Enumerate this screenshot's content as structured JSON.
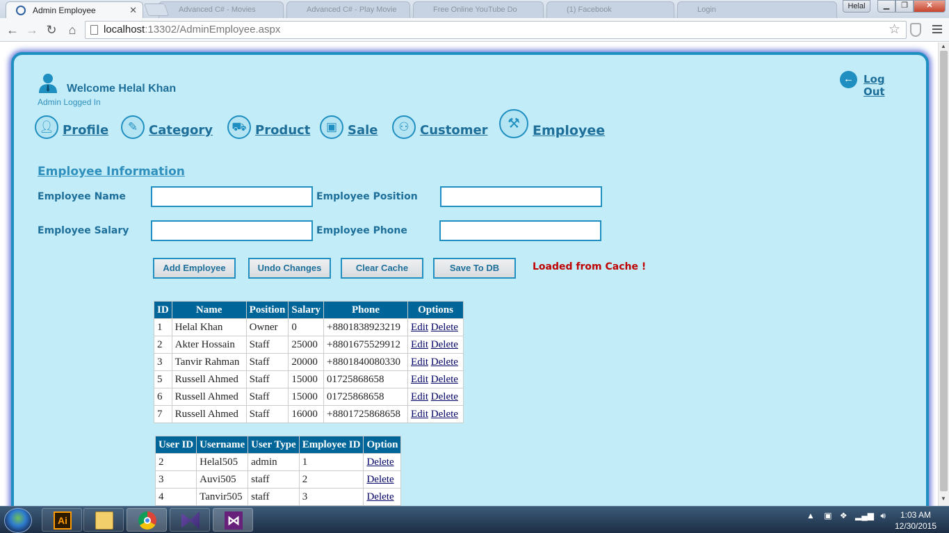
{
  "browser": {
    "active_tab_title": "Admin Employee",
    "background_tabs": [
      "Advanced C# - Movies",
      "Advanced C# - Play Movie",
      "Free Online YouTube Do",
      "(1) Facebook",
      "Login"
    ],
    "profile_name": "Helal",
    "url_host": "localhost",
    "url_rest": ":13302/AdminEmployee.aspx"
  },
  "header": {
    "welcome": "Welcome Helal Khan",
    "subtitle": "Admin Logged In",
    "logout": "Log Out"
  },
  "nav": {
    "items": [
      {
        "label": "Profile",
        "icon": "person-icon"
      },
      {
        "label": "Category",
        "icon": "category-icon"
      },
      {
        "label": "Product",
        "icon": "cart-icon"
      },
      {
        "label": "Sale",
        "icon": "bag-icon"
      },
      {
        "label": "Customer",
        "icon": "customers-icon"
      },
      {
        "label": "Employee",
        "icon": "employee-icon"
      }
    ]
  },
  "form": {
    "title": "Employee Information",
    "name_label": "Employee Name",
    "position_label": "Employee Position",
    "salary_label": "Employee Salary",
    "phone_label": "Employee Phone",
    "name_value": "",
    "position_value": "",
    "salary_value": "",
    "phone_value": "",
    "buttons": {
      "add": "Add Employee",
      "undo": "Undo Changes",
      "clear": "Clear Cache",
      "save": "Save To DB"
    },
    "status": "Loaded from Cache !"
  },
  "employees": {
    "columns": [
      "ID",
      "Name",
      "Position",
      "Salary",
      "Phone",
      "Options"
    ],
    "edit_label": "Edit",
    "delete_label": "Delete",
    "rows": [
      {
        "id": "1",
        "name": "Helal Khan",
        "position": "Owner",
        "salary": "0",
        "phone": "+8801838923219"
      },
      {
        "id": "2",
        "name": "Akter Hossain",
        "position": "Staff",
        "salary": "25000",
        "phone": "+8801675529912"
      },
      {
        "id": "3",
        "name": "Tanvir Rahman",
        "position": "Staff",
        "salary": "20000",
        "phone": "+8801840080330"
      },
      {
        "id": "5",
        "name": "Russell Ahmed",
        "position": "Staff",
        "salary": "15000",
        "phone": "01725868658"
      },
      {
        "id": "6",
        "name": "Russell Ahmed",
        "position": "Staff",
        "salary": "15000",
        "phone": "01725868658"
      },
      {
        "id": "7",
        "name": "Russell Ahmed",
        "position": "Staff",
        "salary": "16000",
        "phone": "+8801725868658"
      }
    ]
  },
  "users": {
    "columns": [
      "User ID",
      "Username",
      "User Type",
      "Employee ID",
      "Option"
    ],
    "delete_label": "Delete",
    "rows": [
      {
        "user_id": "2",
        "username": "Helal505",
        "user_type": "admin",
        "employee_id": "1"
      },
      {
        "user_id": "3",
        "username": "Auvi505",
        "user_type": "staff",
        "employee_id": "2"
      },
      {
        "user_id": "4",
        "username": "Tanvir505",
        "user_type": "staff",
        "employee_id": "3"
      }
    ]
  },
  "taskbar": {
    "time": "1:03 AM",
    "date": "12/30/2015",
    "apps": [
      "explorer",
      "illustrator",
      "file-explorer",
      "chrome",
      "visual-studio-blend",
      "visual-studio"
    ]
  },
  "colors": {
    "panel_bg": "#c2ecf8",
    "panel_border": "#1f8fc2",
    "grid_header": "#006699",
    "status_red": "#c00000"
  }
}
